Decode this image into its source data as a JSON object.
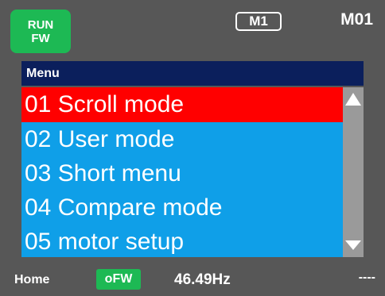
{
  "status": {
    "line1": "RUN",
    "line2": "FW",
    "color": "#1db954"
  },
  "mode_badge": "M1",
  "screen_code": "M01",
  "menu": {
    "title": "Menu",
    "items": [
      {
        "label": "01 Scroll mode",
        "selected": true
      },
      {
        "label": "02 User mode",
        "selected": false
      },
      {
        "label": "03 Short menu",
        "selected": false
      },
      {
        "label": "04 Compare mode",
        "selected": false
      },
      {
        "label": "05 motor setup",
        "selected": false
      }
    ]
  },
  "scrollbar": {
    "up_icon": "triangle-up-icon",
    "down_icon": "triangle-down-icon"
  },
  "footer": {
    "home": "Home",
    "direction": "oFW",
    "frequency": "46.49Hz",
    "right": "----"
  },
  "colors": {
    "background": "#575757",
    "header": "#0b1f5c",
    "list": "#0f9fe8",
    "selected": "#ff0000",
    "scrollbar": "#9a9a9a"
  }
}
